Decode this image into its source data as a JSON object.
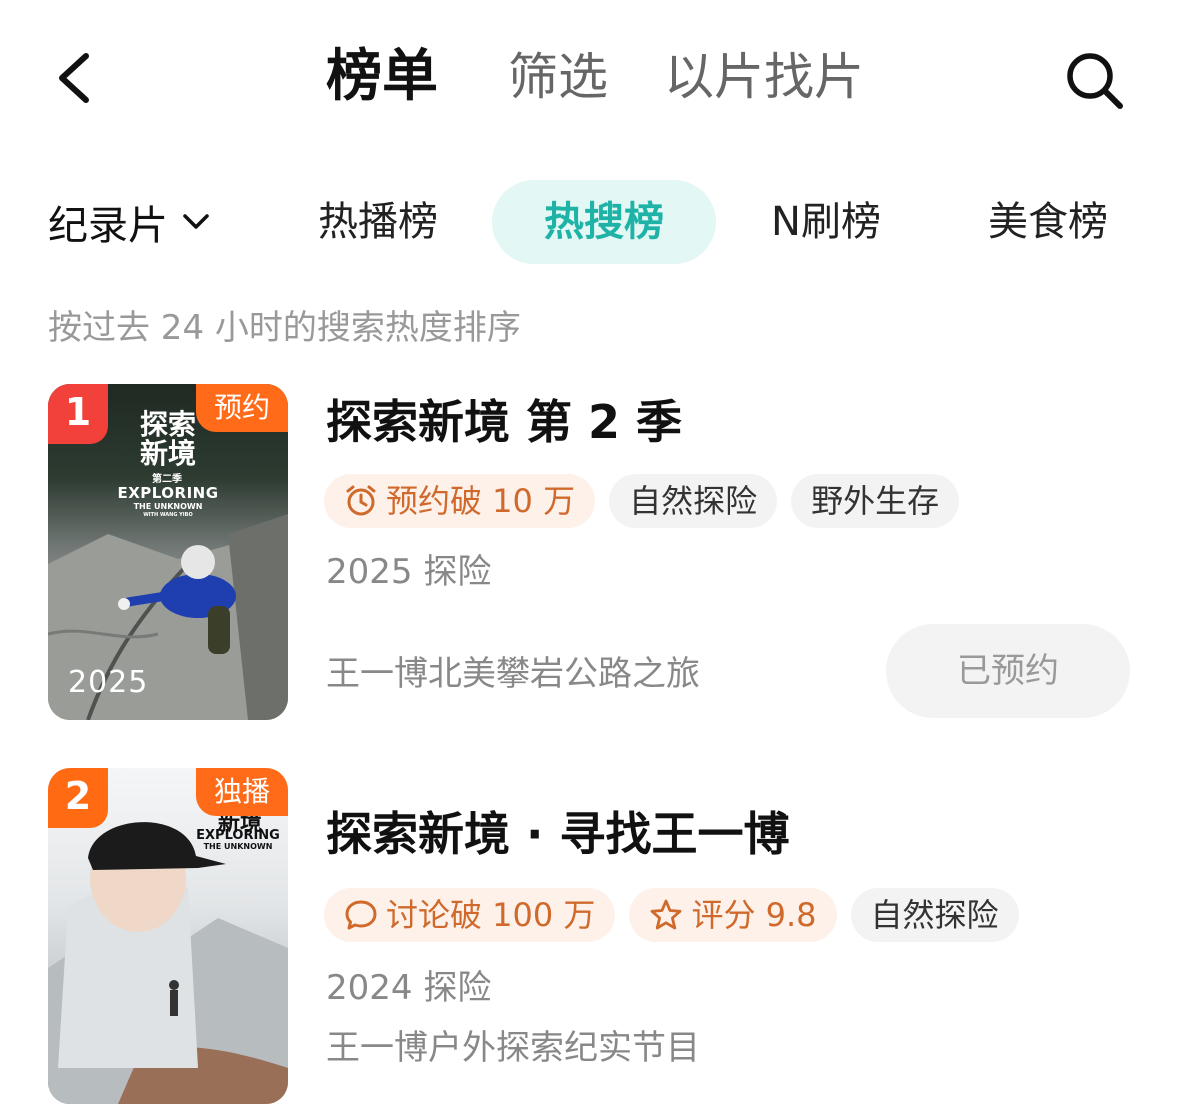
{
  "header": {
    "tabs": [
      {
        "label": "榜单",
        "active": true
      },
      {
        "label": "筛选",
        "active": false
      },
      {
        "label": "以片找片",
        "active": false
      }
    ]
  },
  "category": {
    "selected": "纪录片",
    "tabs": [
      {
        "label": "热播榜",
        "active": false
      },
      {
        "label": "热搜榜",
        "active": true
      },
      {
        "label": "N刷榜",
        "active": false
      },
      {
        "label": "美食榜",
        "active": false
      }
    ]
  },
  "subtitle": "按过去 24 小时的搜索热度排序",
  "items": [
    {
      "rank": "1",
      "badge": "预约",
      "poster_year": "2025",
      "poster_title": "探索\n新境",
      "poster_season": "第二季",
      "poster_en": "EXPLORING",
      "poster_en_sub": "THE UNKNOWN",
      "poster_en_small": "WITH WANG YIBO",
      "title": "探索新境 第 2 季",
      "tags": [
        {
          "icon": "alarm-clock-icon",
          "label": "预约破 10 万",
          "hot": true
        },
        {
          "icon": "",
          "label": "自然探险",
          "hot": false
        },
        {
          "icon": "",
          "label": "野外生存",
          "hot": false
        }
      ],
      "meta": "2025 探险",
      "desc": "王一博北美攀岩公路之旅",
      "button": "已预约",
      "rank_color": "#f2413a"
    },
    {
      "rank": "2",
      "badge": "独播",
      "poster_title": "新境",
      "poster_en": "EXPLORING",
      "poster_en_sub": "THE UNKNOWN",
      "title": "探索新境 · 寻找王一博",
      "tags": [
        {
          "icon": "speech-bubble-icon",
          "label": "讨论破 100 万",
          "hot": true
        },
        {
          "icon": "star-icon",
          "label": "评分 9.8",
          "hot": true
        },
        {
          "icon": "",
          "label": "自然探险",
          "hot": false
        }
      ],
      "meta": "2024 探险",
      "desc": "王一博户外探索纪实节目",
      "rank_color": "#ff6a13"
    }
  ],
  "colors": {
    "accent": "#1fb3a7",
    "accent_bg": "#e3f7f5",
    "hot_text": "#d06a2c",
    "hot_bg": "#fdf1ea",
    "badge": "#ff6b18"
  }
}
